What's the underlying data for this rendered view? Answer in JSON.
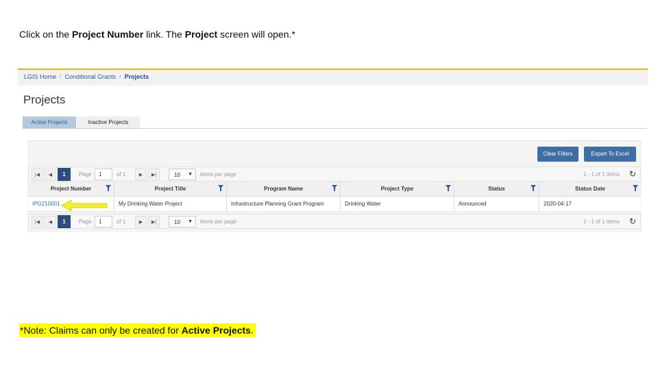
{
  "instruction": {
    "prefix": "Click on the ",
    "bold1": "Project Number",
    "mid": " link. The ",
    "bold2": "Project",
    "suffix": " screen will open.*"
  },
  "breadcrumb": {
    "items": [
      "LGIS Home",
      "Conditional Grants"
    ],
    "separator": "/",
    "current": "Projects"
  },
  "page": {
    "title": "Projects"
  },
  "tabs": [
    {
      "label": "Active Projects",
      "active": true
    },
    {
      "label": "Inactive Projects",
      "active": false
    }
  ],
  "toolbar": {
    "clear_filters": "Clear Filters",
    "export": "Export To Excel"
  },
  "pager": {
    "first_icon": "first-page-icon",
    "prev_icon": "prev-page-icon",
    "current_page": "1",
    "page_label": "Page",
    "page_value": "1",
    "of_label": "of 1",
    "next_icon": "next-page-icon",
    "last_icon": "last-page-icon",
    "page_size": "10",
    "items_per_page": "items per page",
    "info": "1 - 1 of 1 items",
    "refresh_icon": "refresh-icon"
  },
  "grid": {
    "columns": [
      "Project Number",
      "Project Title",
      "Program Name",
      "Project Type",
      "Status",
      "Status Date"
    ],
    "rows": [
      [
        "IPG210001",
        "My Drinking Water Project",
        "Infrastructure Planning Grant Program",
        "Drinking Water",
        "Announced",
        "2020-04-17"
      ]
    ]
  },
  "note": {
    "prefix": "*Note: Claims can only be created for ",
    "bold": "Active Projects",
    "suffix": "."
  },
  "colors": {
    "accent_line": "#e8b500",
    "primary_button": "#3f6ea4",
    "link": "#2a6fb0",
    "highlight": "#ffff00",
    "arrow": "#f2ee3a"
  }
}
